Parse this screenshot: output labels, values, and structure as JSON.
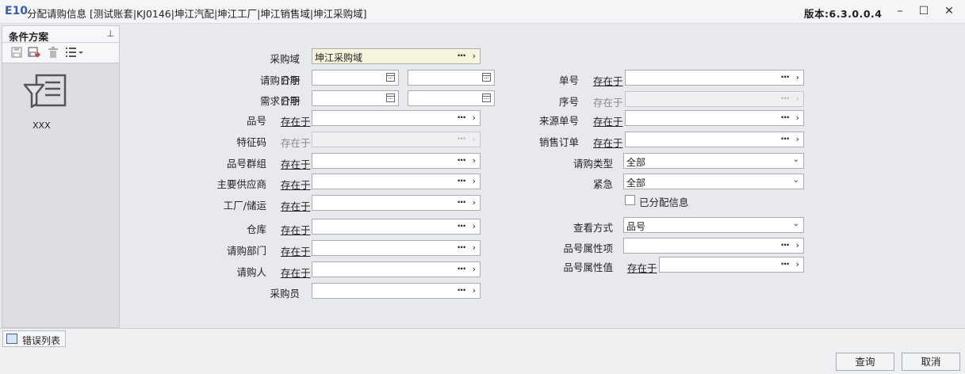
{
  "window": {
    "logo": "E10",
    "title": "分配请购信息 [测试账套|KJ0146|坤江汽配|坤江工厂|坤江销售域|坤江采购域]",
    "version": "版本:6.3.0.0.4",
    "minimize": "–",
    "maximize": "☐",
    "close": "✕"
  },
  "left_panel": {
    "title": "条件方案",
    "pin": "⊥",
    "scheme_label": "XXX"
  },
  "form": {
    "purchase_domain": {
      "label": "采购域",
      "value": "坤江采购域"
    },
    "request_date": {
      "label": "请购日期",
      "op": "介于"
    },
    "demand_date": {
      "label": "需求日期",
      "op": "介于"
    },
    "item_no": {
      "label": "品号",
      "op": "存在于"
    },
    "feature_code": {
      "label": "特征码",
      "op": "存在于"
    },
    "item_group": {
      "label": "品号群组",
      "op": "存在于"
    },
    "main_supplier": {
      "label": "主要供应商",
      "op": "存在于"
    },
    "factory": {
      "label": "工厂/储运",
      "op": "存在于"
    },
    "warehouse": {
      "label": "仓库",
      "op": "存在于"
    },
    "request_dept": {
      "label": "请购部门",
      "op": "存在于"
    },
    "requester": {
      "label": "请购人",
      "op": "存在于"
    },
    "buyer": {
      "label": "采购员"
    },
    "doc_no": {
      "label": "单号",
      "op": "存在于"
    },
    "seq_no": {
      "label": "序号",
      "op": "存在于"
    },
    "source_doc": {
      "label": "来源单号",
      "op": "存在于"
    },
    "sales_order": {
      "label": "销售订单",
      "op": "存在于"
    },
    "request_type": {
      "label": "请购类型",
      "value": "全部"
    },
    "urgent": {
      "label": "紧急",
      "value": "全部"
    },
    "allocated": {
      "label": "已分配信息"
    },
    "view_mode": {
      "label": "查看方式",
      "value": "品号"
    },
    "item_attr": {
      "label": "品号属性项"
    },
    "item_attr_value": {
      "label": "品号属性值",
      "op": "存在于"
    }
  },
  "bottom": {
    "error_tab": "错误列表",
    "query_button": "查询",
    "cancel_button": "取消"
  }
}
